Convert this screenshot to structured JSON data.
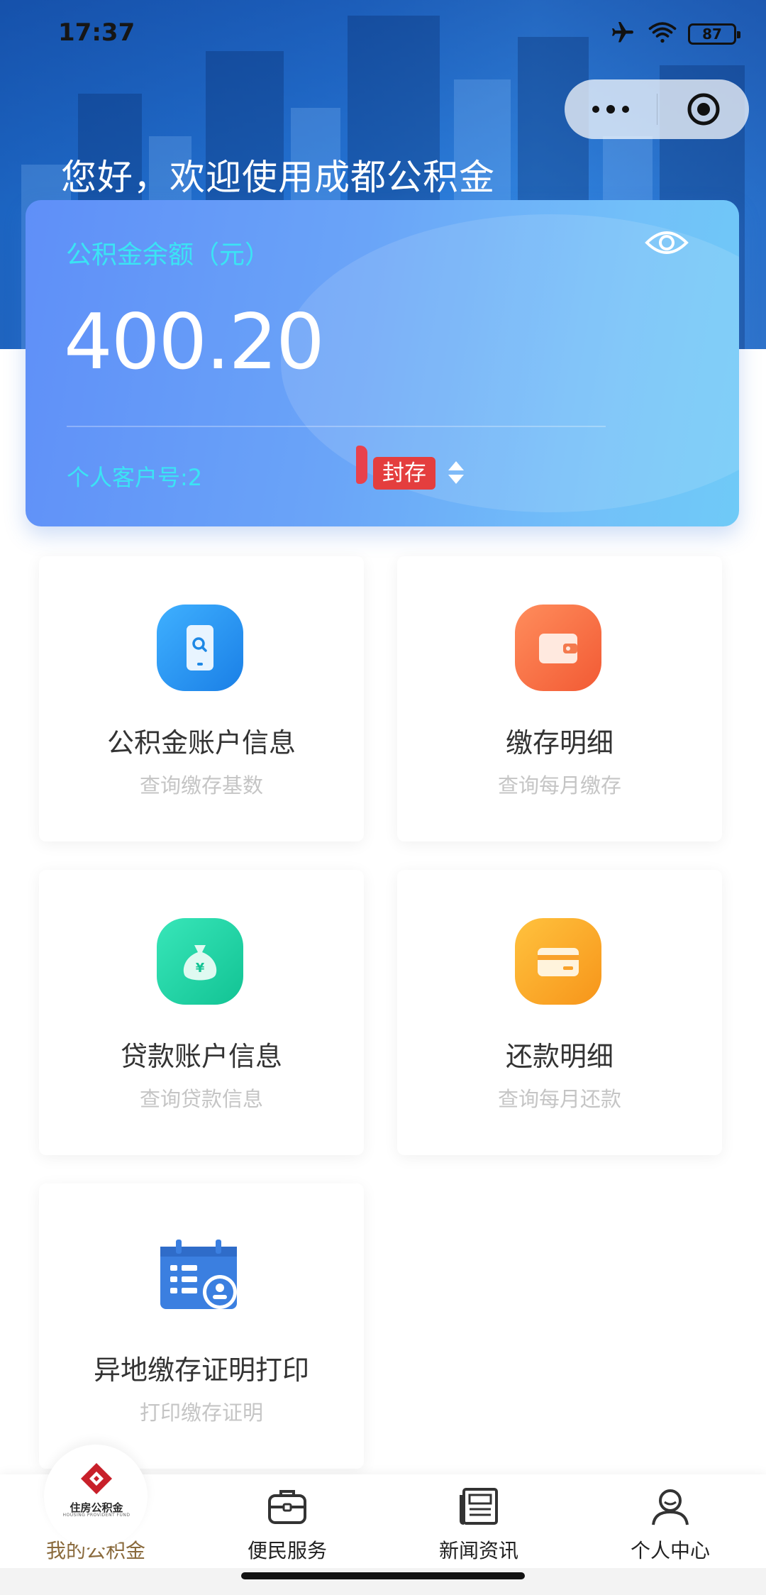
{
  "status_bar": {
    "time": "17:37",
    "battery": "87"
  },
  "header": {
    "greeting": "您好，欢迎使用成都公积金"
  },
  "balance_card": {
    "label": "公积金余额（元）",
    "amount": "400.20",
    "account_no": "个人客户号:2",
    "status": "封存"
  },
  "tiles": [
    {
      "title": "公积金账户信息",
      "subtitle": "查询缴存基数",
      "icon": "phone-search-icon",
      "color": "#2196f3"
    },
    {
      "title": "缴存明细",
      "subtitle": "查询每月缴存",
      "icon": "wallet-icon",
      "color": "#f4683e"
    },
    {
      "title": "贷款账户信息",
      "subtitle": "查询贷款信息",
      "icon": "money-bag-icon",
      "color": "#1ccf9f"
    },
    {
      "title": "还款明细",
      "subtitle": "查询每月还款",
      "icon": "card-icon",
      "color": "#f9a12a"
    },
    {
      "title": "异地缴存证明打印",
      "subtitle": "打印缴存证明",
      "icon": "calendar-certificate-icon",
      "color": "#3b7fe0"
    }
  ],
  "tabbar": {
    "logo_text": "住房公积金",
    "logo_subtext": "HOUSING PROVIDENT FUND",
    "items": [
      {
        "label": "我的公积金",
        "active": true
      },
      {
        "label": "便民服务",
        "active": false
      },
      {
        "label": "新闻资讯",
        "active": false
      },
      {
        "label": "个人中心",
        "active": false
      }
    ]
  },
  "colors": {
    "accent": "#5b8ff7",
    "cyan_text": "#3be4f4",
    "badge_red": "#e43e3e",
    "active_tab": "#8a6a3c"
  }
}
